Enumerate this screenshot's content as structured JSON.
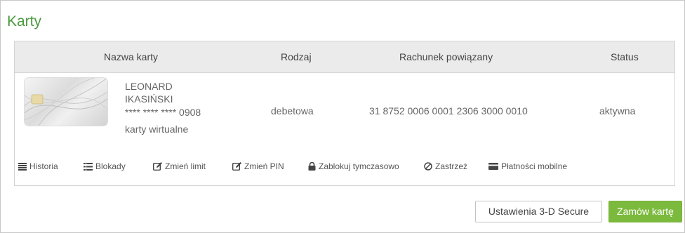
{
  "page": {
    "title": "Karty"
  },
  "table": {
    "headers": [
      "Nazwa karty",
      "Rodzaj",
      "Rachunek powiązany",
      "Status"
    ],
    "rows": [
      {
        "owner_first": "LEONARD",
        "owner_last": "IKASIŃSKI",
        "masked_number": "**** **** **** 0908",
        "card_category": "karty wirtualne",
        "type": "debetowa",
        "account": "31 8752 0006 0001 2306 3000 0010",
        "status": "aktywna"
      }
    ]
  },
  "actions": [
    {
      "label": "Historia",
      "icon": "list-icon"
    },
    {
      "label": "Blokady",
      "icon": "bullet-list-icon"
    },
    {
      "label": "Zmień limit",
      "icon": "edit-icon"
    },
    {
      "label": "Zmień PIN",
      "icon": "edit-icon"
    },
    {
      "label": "Zablokuj tymczasowo",
      "icon": "lock-icon"
    },
    {
      "label": "Zastrzeż",
      "icon": "ban-icon"
    },
    {
      "label": "Płatności mobilne",
      "icon": "credit-card-icon"
    }
  ],
  "buttons": {
    "secure_label": "Ustawienia 3-D Secure",
    "order_label": "Zamów kartę"
  },
  "colors": {
    "accent": "#4a9a3e",
    "button_green": "#7cba3e"
  }
}
